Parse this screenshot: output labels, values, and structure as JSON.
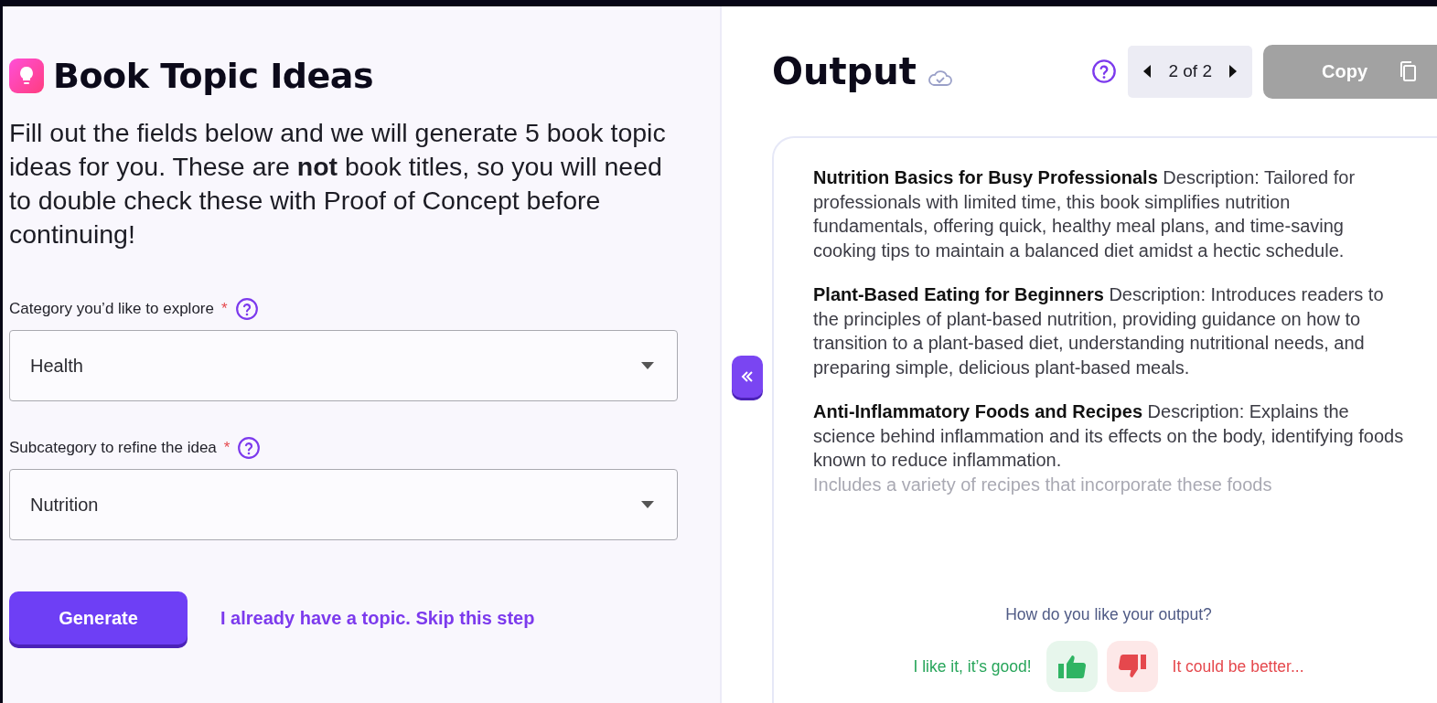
{
  "form": {
    "title": "Book Topic Ideas",
    "intro": "Fill out the fields below and we will generate 5 book topic ideas for you. These are **not** book titles, so you will need to double check these with Proof of Concept before continuing!",
    "fields": [
      {
        "label": "Category you’d like to explore",
        "required_mark": "*",
        "value": "Health"
      },
      {
        "label": "Subcategory to refine the idea",
        "required_mark": "*",
        "value": "Nutrition"
      }
    ],
    "generate_button": "Generate",
    "skip_link": "I already have a topic. Skip this step"
  },
  "output": {
    "title": "Output",
    "pager": "2 of 2",
    "copy_button": "Copy",
    "ideas": [
      {
        "text": "**Nutrition Basics for Busy Professionals** Description: Tailored for professionals with limited time, this book simplifies nutrition fundamentals, offering quick, healthy meal plans, and time-saving cooking tips to maintain a balanced diet amidst a hectic schedule."
      },
      {
        "text": "**Plant-Based Eating for Beginners** Description: Introduces readers to the principles of plant-based nutrition, providing guidance on how to transition to a plant-based diet, understanding nutritional needs, and preparing simple, delicious plant-based meals."
      },
      {
        "text": "**Anti-Inflammatory Foods and Recipes** Description: Explains the science behind inflammation and its effects on the body, identifying foods known to reduce inflammation."
      }
    ],
    "faded_line": "Includes a variety of recipes that incorporate these foods",
    "feedback": {
      "question": "How do you like your output?",
      "good_label": "I like it, it’s good!",
      "bad_label": "It could be better..."
    }
  }
}
